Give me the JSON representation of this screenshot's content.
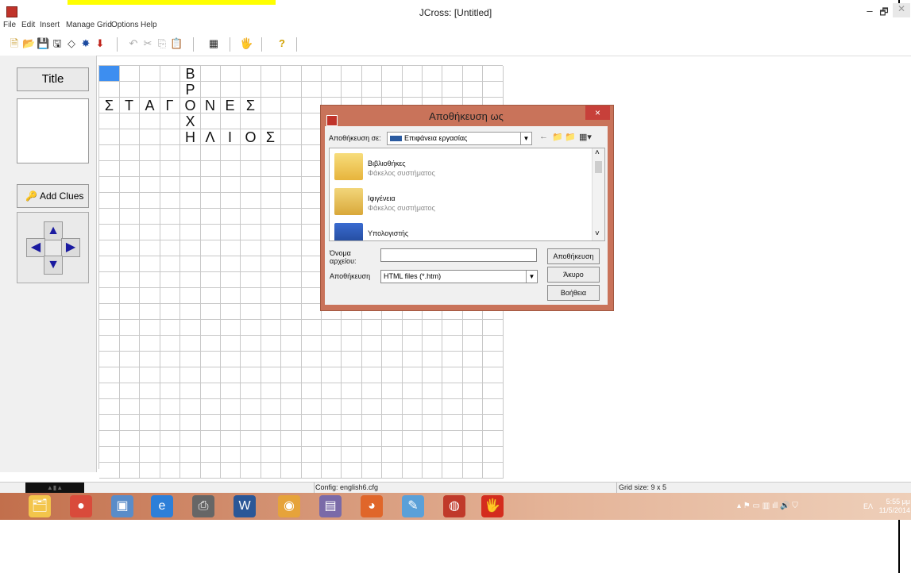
{
  "window": {
    "title": "JCross: [Untitled]",
    "minimize": "–",
    "restore": "🗗",
    "close": "✕"
  },
  "menu": [
    "File",
    "Edit",
    "Insert",
    "Manage Grid",
    "Options",
    "Help"
  ],
  "toolbar": {
    "icons": [
      "new-icon",
      "open-icon",
      "save-icon",
      "save-as-icon",
      "eraser-icon",
      "web-export-icon",
      "down-arrow-icon",
      "undo-icon",
      "cut-icon",
      "copy-icon",
      "paste-icon",
      "grid-icon",
      "hotpotatoes-icon",
      "help-icon"
    ],
    "glyphs": {
      "new": "🗎",
      "open": "📂",
      "save": "💾",
      "save_as": "🖫",
      "eraser": "◇",
      "web": "✸",
      "down": "⬇",
      "undo": "↶",
      "cut": "✂",
      "copy": "⎘",
      "paste": "📋",
      "grid": "▦",
      "hp": "🖐",
      "help": "?"
    }
  },
  "left_panel": {
    "title_button": "Title",
    "add_clues_button": "Add Clues",
    "key_glyph": "🔑",
    "arrows": {
      "up": "▲",
      "left": "◀",
      "right": "▶",
      "down": "▼"
    }
  },
  "grid": {
    "rows": 26,
    "cols": 20,
    "selected_color": "#3d8ef0",
    "letters": [
      {
        "r": 0,
        "c": 4,
        "ch": "Β"
      },
      {
        "r": 1,
        "c": 4,
        "ch": "Ρ"
      },
      {
        "r": 2,
        "c": 0,
        "ch": "Σ"
      },
      {
        "r": 2,
        "c": 1,
        "ch": "Τ"
      },
      {
        "r": 2,
        "c": 2,
        "ch": "Α"
      },
      {
        "r": 2,
        "c": 3,
        "ch": "Γ"
      },
      {
        "r": 2,
        "c": 4,
        "ch": "Ο"
      },
      {
        "r": 2,
        "c": 5,
        "ch": "Ν"
      },
      {
        "r": 2,
        "c": 6,
        "ch": "Ε"
      },
      {
        "r": 2,
        "c": 7,
        "ch": "Σ"
      },
      {
        "r": 3,
        "c": 4,
        "ch": "Χ"
      },
      {
        "r": 4,
        "c": 4,
        "ch": "Η"
      },
      {
        "r": 4,
        "c": 5,
        "ch": "Λ"
      },
      {
        "r": 4,
        "c": 6,
        "ch": "Ι"
      },
      {
        "r": 4,
        "c": 7,
        "ch": "Ο"
      },
      {
        "r": 4,
        "c": 8,
        "ch": "Σ"
      }
    ]
  },
  "dialog": {
    "title": "Αποθήκευση ως",
    "close": "×",
    "save_in_label": "Αποθήκευση σε:",
    "save_in_value": "Επιφάνεια εργασίας",
    "files": [
      {
        "name": "Βιβλιοθήκες",
        "desc": "Φάκελος συστήματος",
        "icon": "libraries-folder-icon"
      },
      {
        "name": "Ιφιγένεια",
        "desc": "Φάκελος συστήματος",
        "icon": "user-folder-icon"
      },
      {
        "name": "Υπολογιστής",
        "desc": "",
        "icon": "computer-icon"
      }
    ],
    "filename_label": "Όνομα αρχείου:",
    "filename_value": "",
    "savetype_label": "Αποθήκευση",
    "savetype_value": "HTML files (*.htm)",
    "save_button": "Αποθήκευση",
    "cancel_button": "Άκυρο",
    "help_button": "Βοήθεια",
    "dropdown_glyph": "▼",
    "back_glyph": "←",
    "up_glyph": "📁",
    "newfolder_glyph": "📁",
    "views_glyph": "▦▾",
    "scroll_up": "˄",
    "scroll_down": "˅"
  },
  "status": {
    "left": "▲▮▲",
    "config": "Config: english6.cfg",
    "grid_size": "Grid size: 9 x 5"
  },
  "taskbar": {
    "apps": [
      {
        "name": "file-explorer-icon",
        "glyph": "🗂",
        "bg": "#f3c54b"
      },
      {
        "name": "chrome-like-icon",
        "glyph": "●",
        "bg": "#d94b3b"
      },
      {
        "name": "app-blue-icon",
        "glyph": "▣",
        "bg": "#5a8cc8"
      },
      {
        "name": "internet-explorer-icon",
        "glyph": "e",
        "bg": "#2d7fd8"
      },
      {
        "name": "scanner-icon",
        "glyph": "⎙",
        "bg": "#666666"
      },
      {
        "name": "word-icon",
        "glyph": "W",
        "bg": "#2b5797"
      },
      {
        "name": "chrome-icon",
        "glyph": "◉",
        "bg": "#e6a33a"
      },
      {
        "name": "photo-icon",
        "glyph": "▤",
        "bg": "#7a6aa8"
      },
      {
        "name": "firefox-icon",
        "glyph": "◕",
        "bg": "#e0662a"
      },
      {
        "name": "paint-icon",
        "glyph": "✎",
        "bg": "#5aa0d8"
      },
      {
        "name": "media-icon",
        "glyph": "◍",
        "bg": "#c03a2a"
      },
      {
        "name": "hotpotatoes-taskbar-icon",
        "glyph": "🖐",
        "bg": "#d42c1e"
      }
    ],
    "tray_icons": "▴  ⚑  ▭  ▥  ıll  🔊  ⛉",
    "language": "ΕΛ",
    "time": "5:55 μμ",
    "date": "11/5/2014"
  }
}
